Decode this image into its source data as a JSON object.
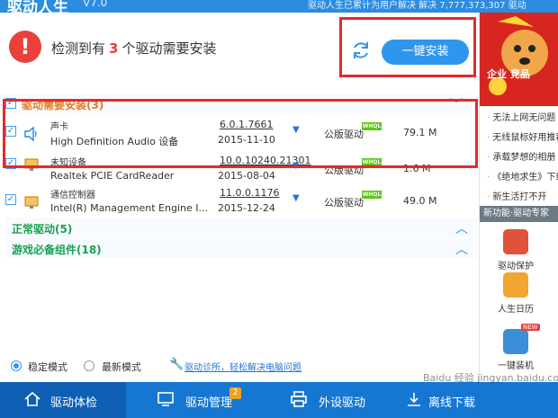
{
  "app": {
    "title": "驱动人生",
    "version": "V7.0",
    "notice": "驱动人生已累计为用户解决     解决 7,777,373,307     驱动"
  },
  "header": {
    "alert_prefix": "检测到有",
    "alert_count": "3",
    "alert_suffix": "个驱动需要安装",
    "install_all_label": "一键安装"
  },
  "sections": {
    "needs_install": "驱动需要安装(3)",
    "normal": "正常驱动(5)",
    "game": "游戏必备组件(18)"
  },
  "drivers": [
    {
      "name": "声卡",
      "desc": "High Definition Audio 设备",
      "version": "6.0.1.7661",
      "date": "2015-11-10",
      "type": "公版驱动",
      "whql": "WHQL",
      "size": "79.1 M"
    },
    {
      "name": "未知设备",
      "desc": "Realtek PCIE CardReader",
      "version": "10.0.10240.21301",
      "date": "2015-08-04",
      "type": "公版驱动",
      "whql": "WHQL",
      "size": "1.6 M"
    },
    {
      "name": "通信控制器",
      "desc": "Intel(R) Management Engine I...",
      "version": "11.0.0.1176",
      "date": "2015-12-24",
      "type": "公版驱动",
      "whql": "WHQL",
      "size": "49.0 M"
    }
  ],
  "bottom": {
    "stable_mode": "稳定模式",
    "latest_mode": "最新模式",
    "diag_link": "驱动诊所，轻松解决电脑问题"
  },
  "nav": [
    {
      "label": "驱动体检",
      "icon": "home-icon"
    },
    {
      "label": "驱动管理",
      "icon": "monitor-icon",
      "badge": "2"
    },
    {
      "label": "外设驱动",
      "icon": "printer-icon"
    },
    {
      "label": "离线下载",
      "icon": "download-icon"
    }
  ],
  "side": {
    "banner_text": "企业 竞品",
    "news": [
      "无法上网无问题",
      "无线鼠标好用推荐",
      "承载梦想的相册",
      "《绝地求生》下载",
      "新生活打不开"
    ],
    "section_title": "新功能·驱动专家",
    "tools": [
      {
        "label": "驱动保护",
        "icon": "shield-icon"
      },
      {
        "label": "人生日历",
        "icon": "calendar-icon"
      },
      {
        "label": "一键装机",
        "icon": "install-icon",
        "tag": "NEW"
      }
    ]
  },
  "watermark": "Baidu 经验 jingyan.baidu.com",
  "colors": {
    "accent": "#2f96ee",
    "alert": "#e9403a",
    "highlight": "#e8282d",
    "nav": "#1677d2"
  }
}
